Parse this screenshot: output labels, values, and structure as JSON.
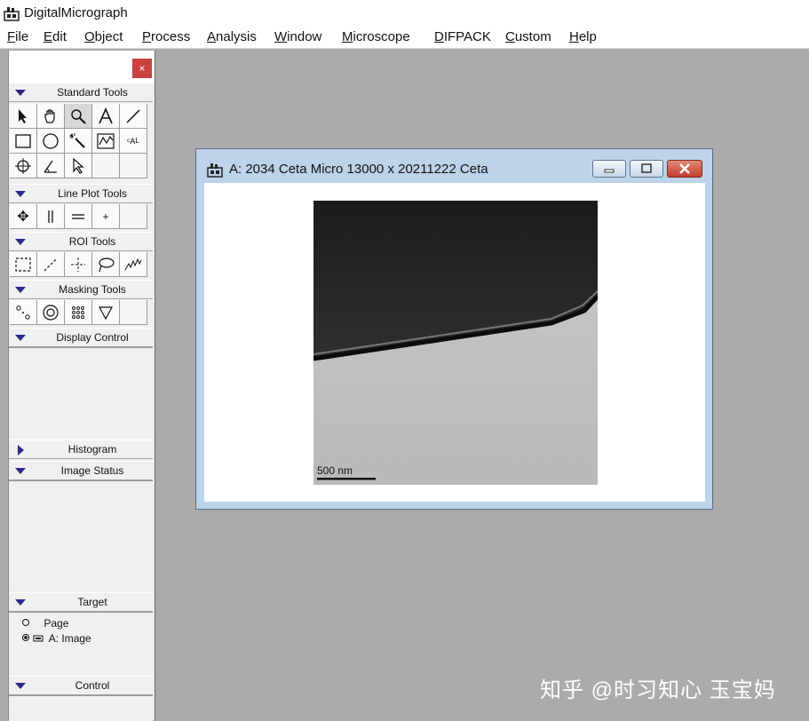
{
  "app": {
    "title": "DigitalMicrograph"
  },
  "menu": [
    {
      "accel": "F",
      "rest": "ile"
    },
    {
      "accel": "E",
      "rest": "dit"
    },
    {
      "accel": "O",
      "rest": "bject"
    },
    {
      "accel": "P",
      "rest": "rocess"
    },
    {
      "accel": "A",
      "rest": "nalysis"
    },
    {
      "accel": "W",
      "rest": "indow"
    },
    {
      "accel": "M",
      "rest": "icroscope"
    },
    {
      "accel": "D",
      "rest": "IFPACK"
    },
    {
      "accel": "C",
      "rest": "ustom"
    },
    {
      "accel": "H",
      "rest": "elp"
    }
  ],
  "palette": {
    "close_glyph": "×",
    "sections": {
      "standard_tools": "Standard Tools",
      "line_plot_tools": "Line Plot Tools",
      "roi_tools": "ROI Tools",
      "masking_tools": "Masking Tools",
      "display_control": "Display Control",
      "histogram": "Histogram",
      "image_status": "Image Status",
      "target": "Target",
      "control": "Control"
    },
    "target_items": [
      {
        "label": "Page",
        "selected": false
      },
      {
        "label": "A: Image",
        "selected": true
      }
    ]
  },
  "image_window": {
    "title": "A: 2034 Ceta Micro 13000 x 20211222 Ceta",
    "scale_bar_label": "500 nm"
  },
  "watermark": "知乎 @时习知心 玉宝妈"
}
